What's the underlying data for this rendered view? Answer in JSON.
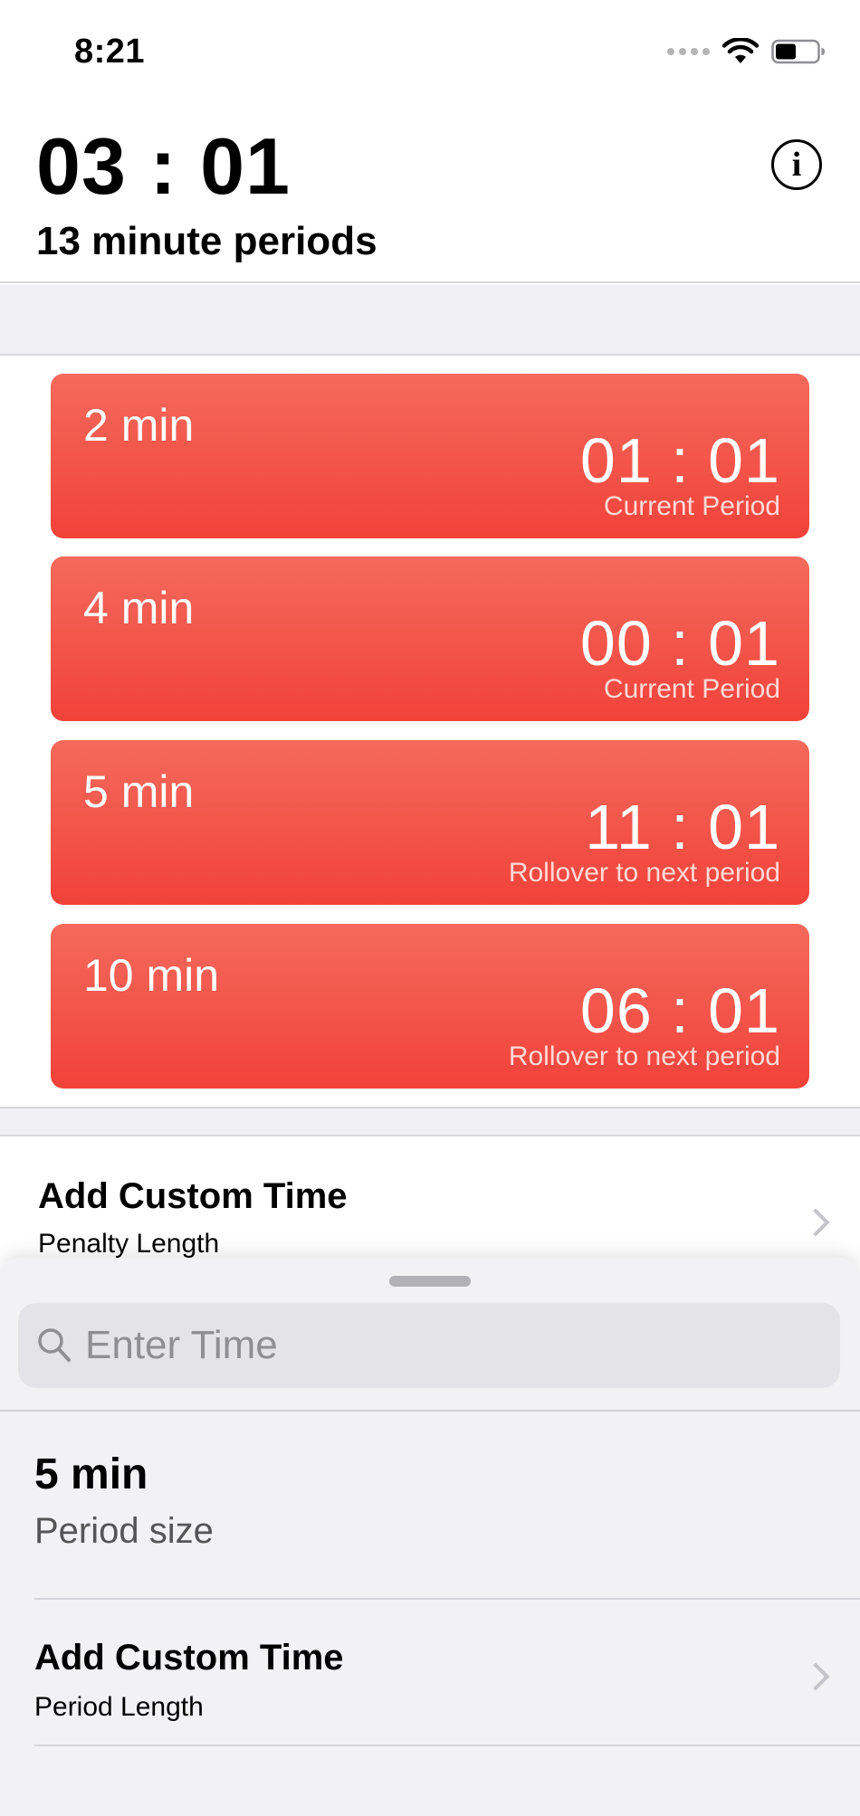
{
  "status_bar": {
    "time": "8:21",
    "icons": [
      "signal-dots-icon",
      "wifi-icon",
      "battery-icon"
    ]
  },
  "header": {
    "clock": "03 : 01",
    "subtitle": "13 minute periods",
    "info_icon": "i"
  },
  "penalties": [
    {
      "label": "2 min",
      "time": "01 : 01",
      "note": "Current Period"
    },
    {
      "label": "4 min",
      "time": "00 : 01",
      "note": "Current Period"
    },
    {
      "label": "5 min",
      "time": "11 : 01",
      "note": "Rollover to next period"
    },
    {
      "label": "10 min",
      "time": "06 : 01",
      "note": "Rollover to next period"
    }
  ],
  "custom_penalty": {
    "title": "Add Custom Time",
    "subtitle": "Penalty Length"
  },
  "sheet": {
    "search_placeholder": "Enter Time",
    "search_value": "",
    "period": {
      "title": "5 min",
      "subtitle": "Period size"
    },
    "custom_period": {
      "title": "Add Custom Time",
      "subtitle": "Period Length"
    }
  },
  "colors": {
    "card_gradient_top": "#f46a5c",
    "card_gradient_bottom": "#f2423a",
    "section_background": "#efeff4",
    "sheet_background": "#f2f2f4"
  }
}
